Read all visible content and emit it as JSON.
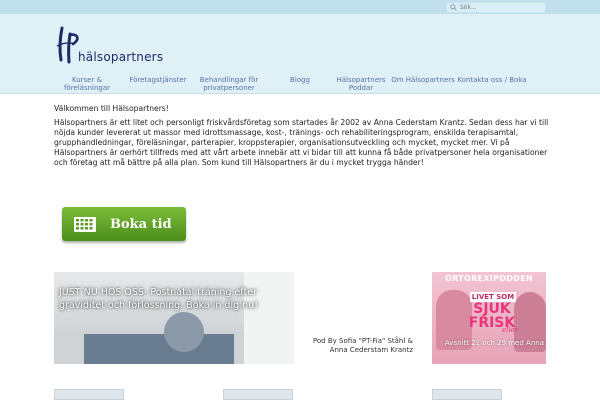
{
  "search": {
    "placeholder": "Sök..."
  },
  "brand": {
    "logo_text": "hälsopartners"
  },
  "nav": {
    "items": [
      {
        "id": "kurser",
        "label": "Kurser & föreläsningar"
      },
      {
        "id": "foretag",
        "label": "Företagstjänster"
      },
      {
        "id": "behandlingar",
        "label": "Behandlingar för privatpersoner"
      },
      {
        "id": "blogg",
        "label": "Blogg"
      },
      {
        "id": "poddar",
        "label": "Hälsopartners Poddar"
      },
      {
        "id": "om",
        "label": "Om Hälsopartners"
      },
      {
        "id": "kontakt",
        "label": "Kontakta oss / Boka"
      }
    ]
  },
  "content": {
    "welcome": "Välkommen till Hälsopartners!",
    "body": "Hälsopartners är ett litet och personligt friskvårdsföretag som startades år 2002 av Anna Cederstam Krantz. Sedan dess har vi till nöjda kunder levererat ut massor med idrottsmassage, kost-, tränings- och rehabiliteringsprogram, enskilda terapisamtal, grupphandledningar, föreläsningar, parterapier, kroppsterapier, organisationsutveckling och mycket, mycket mer. Vi på Hälsopartners är oerhört tillfreds med att vårt arbete innebär att vi bidar till att kunna få både privatpersoner hela organisationer och företag att må bättre på alla plan. Som kund till Hälsopartners är du i mycket trygga händer!"
  },
  "cta": {
    "label": "Boka tid"
  },
  "feature": {
    "caption": "JUST NU HOS OSS- Postnatal träning efter graviditet och förlossning. Boka in dig nu!"
  },
  "pod": {
    "credit": "Pod By Sofia \"PT-Fia\" Ståhl & Anna Cederstam Krantz"
  },
  "podcast": {
    "title": "ORTOREXIPODDEN",
    "livet": "LIVET SOM",
    "sjuk": "SJUK",
    "frisk": "FRISK",
    "eller": "eller",
    "avsnitt": "Avsnitt 21 och 29 med Anna"
  },
  "colors": {
    "header_bg": "#dff0f6",
    "topbar_bg": "#bfe0ec",
    "nav_text": "#5673a8",
    "cta_green": "#5fa128",
    "podcast_pink": "#e9357b"
  }
}
